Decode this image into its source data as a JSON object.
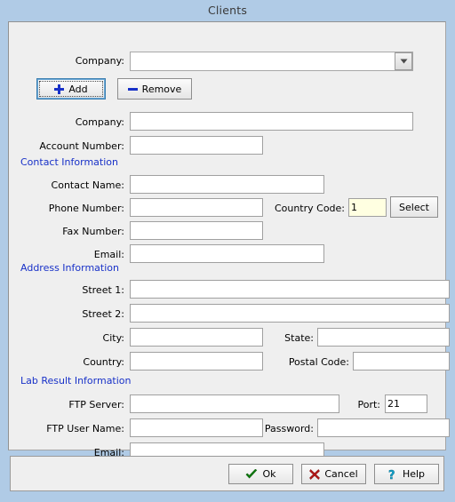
{
  "window": {
    "title": "Clients",
    "titlebar_color": "#b0cbe6",
    "panel_color": "#efefef"
  },
  "top": {
    "company_label": "Company:",
    "company_value": "",
    "company_placeholder": "",
    "dropdown_icon": "chevron-down-icon",
    "add_button": {
      "label": "Add",
      "icon": "plus-icon",
      "icon_color": "#1831c8",
      "focused": true
    },
    "remove_button": {
      "label": "Remove",
      "icon": "minus-icon",
      "icon_color": "#1831c8",
      "focused": false
    }
  },
  "details": {
    "company_label": "Company:",
    "company_value": "",
    "account_number_label": "Account Number:",
    "account_number_value": ""
  },
  "sections": [
    {
      "id": "contact",
      "title": "Contact Information"
    },
    {
      "id": "address",
      "title": "Address Information"
    },
    {
      "id": "lab",
      "title": "Lab Result Information"
    }
  ],
  "contact": {
    "contact_name_label": "Contact Name:",
    "contact_name_value": "",
    "phone_number_label": "Phone Number:",
    "phone_number_value": "",
    "country_code_label": "Country Code:",
    "country_code_value": "1",
    "country_code_bg": "#ffffe1",
    "select_button_label": "Select",
    "fax_number_label": "Fax Number:",
    "fax_number_value": "",
    "email_label": "Email:",
    "email_value": ""
  },
  "address": {
    "street1_label": "Street 1:",
    "street1_value": "",
    "street2_label": "Street 2:",
    "street2_value": "",
    "city_label": "City:",
    "city_value": "",
    "state_label": "State:",
    "state_value": "",
    "country_label": "Country:",
    "country_value": "",
    "postal_code_label": "Postal Code:",
    "postal_code_value": ""
  },
  "lab": {
    "ftp_server_label": "FTP Server:",
    "ftp_server_value": "",
    "port_label": "Port:",
    "port_value": "21",
    "ftp_user_name_label": "FTP User Name:",
    "ftp_user_name_value": "",
    "password_label": "Password:",
    "password_value": "",
    "email_label": "Email:",
    "email_value": ""
  },
  "footer": {
    "ok_button": {
      "label": "Ok",
      "icon": "check-icon",
      "icon_color": "#108010"
    },
    "cancel_button": {
      "label": "Cancel",
      "icon": "x-icon",
      "icon_color": "#b01616"
    },
    "help_button": {
      "label": "Help",
      "icon": "question-mark-icon",
      "icon_color": "#14a0c8"
    }
  }
}
